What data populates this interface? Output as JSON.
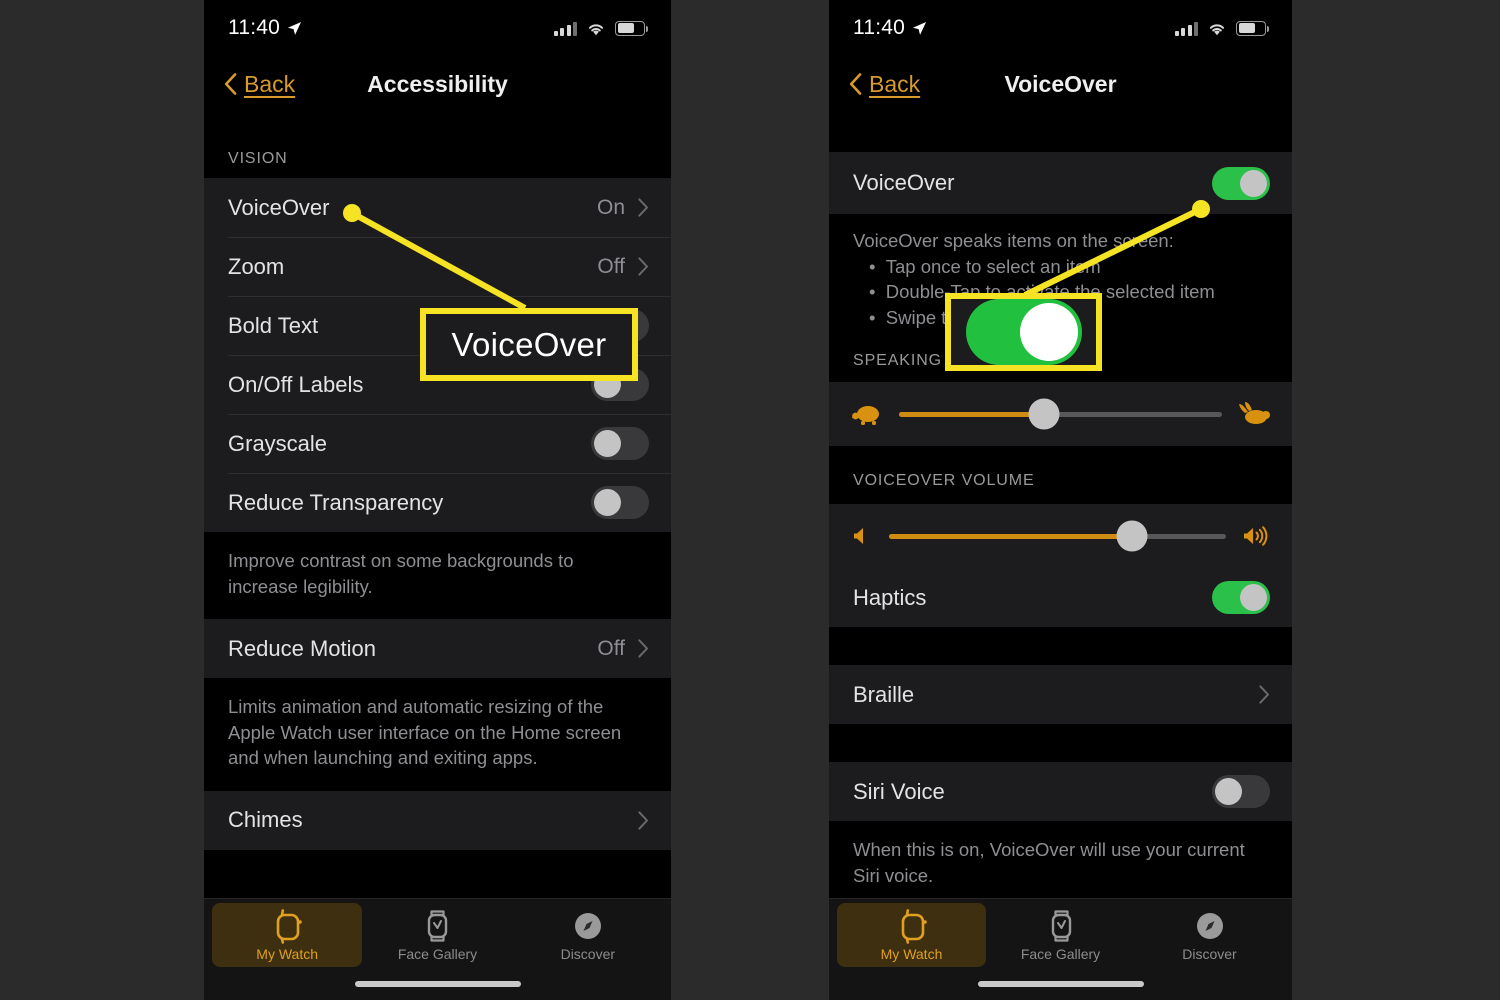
{
  "meta": {
    "accent_orange": "#d79a2b",
    "accent_green": "#2bc04a",
    "highlight_yellow": "#f5e324"
  },
  "left_phone": {
    "status": {
      "time": "11:40",
      "location_icon": "location-arrow-icon",
      "signal_icon": "cellular-signal-icon",
      "wifi_icon": "wifi-icon",
      "battery_icon": "battery-icon"
    },
    "nav": {
      "back_label": "Back",
      "title": "Accessibility"
    },
    "section_header": "VISION",
    "rows": [
      {
        "label": "VoiceOver",
        "value": "On",
        "type": "disclosure"
      },
      {
        "label": "Zoom",
        "value": "Off",
        "type": "disclosure"
      },
      {
        "label": "Bold Text",
        "value": "",
        "type": "toggle",
        "on": false
      },
      {
        "label": "On/Off Labels",
        "value": "",
        "type": "toggle",
        "on": false
      },
      {
        "label": "Grayscale",
        "value": "",
        "type": "toggle",
        "on": false
      },
      {
        "label": "Reduce Transparency",
        "value": "",
        "type": "toggle",
        "on": false
      }
    ],
    "footnote_1": "Improve contrast on some backgrounds to increase legibility.",
    "rows_2": [
      {
        "label": "Reduce Motion",
        "value": "Off",
        "type": "disclosure"
      }
    ],
    "footnote_2": "Limits animation and automatic resizing of the Apple Watch user interface on the Home screen and when launching and exiting apps.",
    "rows_3": [
      {
        "label": "Chimes",
        "value": "",
        "type": "disclosure"
      }
    ],
    "tabs": [
      {
        "label": "My Watch",
        "icon": "apple-watch-icon",
        "active": true
      },
      {
        "label": "Face Gallery",
        "icon": "watch-face-icon",
        "active": false
      },
      {
        "label": "Discover",
        "icon": "compass-icon",
        "active": false
      }
    ],
    "callout": {
      "text": "VoiceOver"
    }
  },
  "right_phone": {
    "status": {
      "time": "11:40",
      "location_icon": "location-arrow-icon",
      "signal_icon": "cellular-signal-icon",
      "wifi_icon": "wifi-icon",
      "battery_icon": "battery-icon"
    },
    "nav": {
      "back_label": "Back",
      "title": "VoiceOver"
    },
    "voiceover_row": {
      "label": "VoiceOver",
      "type": "toggle",
      "on": true
    },
    "description": {
      "intro": "VoiceOver speaks items on the screen:",
      "bullets": [
        "Tap once to select an item",
        "Double-Tap to activate the selected item",
        "Swipe two"
      ]
    },
    "speaking_rate_header": "SPEAKING",
    "speaking_rate_slider": {
      "value_percent": 45,
      "left_icon": "turtle-icon",
      "right_icon": "rabbit-icon"
    },
    "volume_header": "VOICEOVER VOLUME",
    "volume_slider": {
      "value_percent": 72,
      "left_icon": "speaker-low-icon",
      "right_icon": "speaker-high-icon"
    },
    "rows": [
      {
        "label": "Haptics",
        "type": "toggle",
        "on": true
      },
      {
        "label": "Braille",
        "type": "disclosure",
        "value": ""
      },
      {
        "label": "Siri Voice",
        "type": "toggle",
        "on": false
      }
    ],
    "footnote": "When this is on, VoiceOver will use your current Siri voice.",
    "tabs": [
      {
        "label": "My Watch",
        "icon": "apple-watch-icon",
        "active": true
      },
      {
        "label": "Face Gallery",
        "icon": "watch-face-icon",
        "active": false
      },
      {
        "label": "Discover",
        "icon": "compass-icon",
        "active": false
      }
    ],
    "callout": {
      "toggle_on": true
    }
  }
}
